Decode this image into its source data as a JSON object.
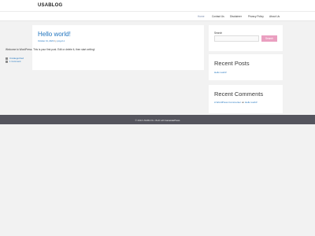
{
  "site": {
    "title": "USABLOG"
  },
  "nav": {
    "items": [
      {
        "label": "Home"
      },
      {
        "label": "Contact Us"
      },
      {
        "label": "Disclaimer"
      },
      {
        "label": "Privacy Policy"
      },
      {
        "label": "About Us"
      }
    ]
  },
  "post": {
    "title": "Hello world!",
    "meta_date": "October 31, 2023",
    "meta_by": "by",
    "meta_author": "prog-0-1",
    "body": "Welcome to WordPress. This is your first post. Edit or delete it, then start writing!",
    "category": "Uncategorized",
    "comments": "1 Comment"
  },
  "sidebar": {
    "search": {
      "label": "Search",
      "placeholder": "",
      "button": "Search"
    },
    "recent_posts": {
      "title": "Recent Posts",
      "items": [
        {
          "label": "Hello world!"
        }
      ]
    },
    "recent_comments": {
      "title": "Recent Comments",
      "items": [
        {
          "author": "A WordPress Commenter",
          "on": "on",
          "post": "Hello world!"
        }
      ]
    }
  },
  "footer": {
    "prefix": "© 2024 USABLOG",
    "middle": "• Built with",
    "link": "GeneratePress"
  },
  "colors": {
    "accent": "#1e73be",
    "button": "#ea9fc0",
    "footer_bg": "#55555e"
  }
}
